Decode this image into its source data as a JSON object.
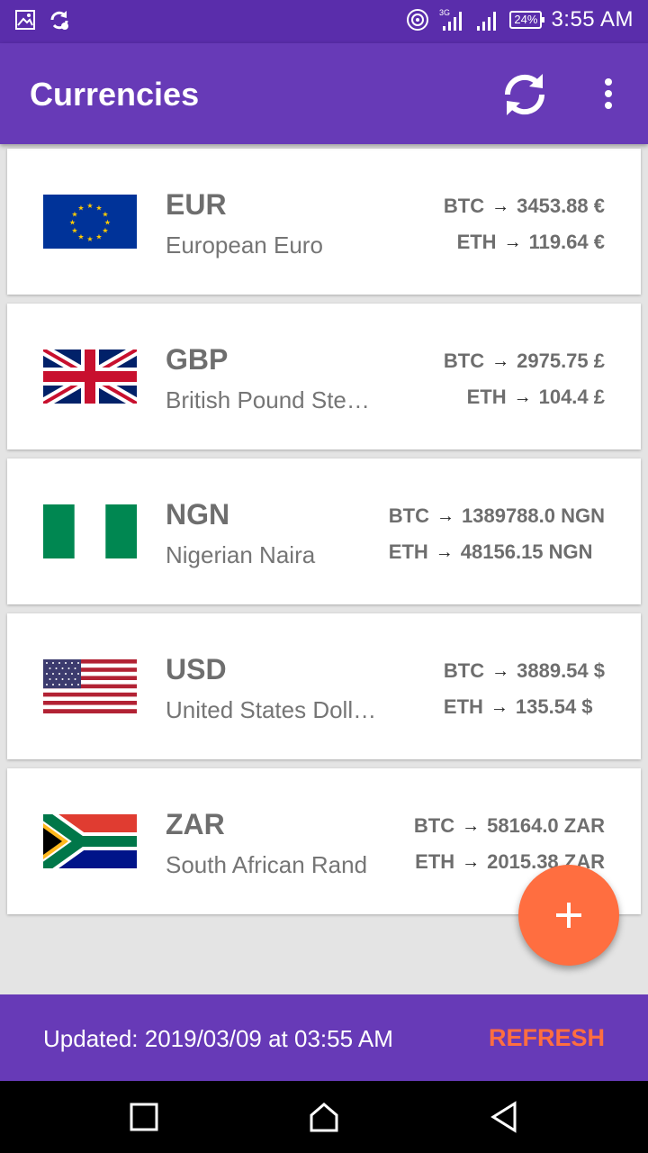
{
  "status_bar": {
    "time": "3:55 AM",
    "battery": "24%",
    "network": "3G"
  },
  "app_bar": {
    "title": "Currencies",
    "refresh_icon": "sync-icon",
    "more_icon": "more-vert-icon"
  },
  "currencies": [
    {
      "code": "EUR",
      "name": "European Euro",
      "flag": "eu-flag-icon",
      "rates": [
        {
          "label": "BTC",
          "value": "3453.88 €"
        },
        {
          "label": "ETH",
          "value": "119.64 €"
        }
      ]
    },
    {
      "code": "GBP",
      "name": "British Pound Ste…",
      "flag": "uk-flag-icon",
      "rates": [
        {
          "label": "BTC",
          "value": "2975.75 £"
        },
        {
          "label": "ETH",
          "value": "104.4 £"
        }
      ]
    },
    {
      "code": "NGN",
      "name": "Nigerian Naira",
      "flag": "nigeria-flag-icon",
      "rates": [
        {
          "label": "BTC",
          "value": "1389788.0 NGN"
        },
        {
          "label": "ETH",
          "value": "48156.15 NGN"
        }
      ]
    },
    {
      "code": "USD",
      "name": "United States Doll…",
      "flag": "us-flag-icon",
      "rates": [
        {
          "label": "BTC",
          "value": "3889.54 $"
        },
        {
          "label": "ETH",
          "value": "135.54 $"
        }
      ]
    },
    {
      "code": "ZAR",
      "name": "South African Rand",
      "flag": "south-africa-flag-icon",
      "rates": [
        {
          "label": "BTC",
          "value": "58164.0 ZAR"
        },
        {
          "label": "ETH",
          "value": "2015.38 ZAR"
        }
      ]
    }
  ],
  "arrow_glyph": "→",
  "fab": {
    "icon": "add-icon"
  },
  "footer": {
    "updated": "Updated: 2019/03/09 at 03:55 AM",
    "refresh_label": "REFRESH"
  },
  "colors": {
    "primary": "#673ab7",
    "primary_dark": "#5a2dab",
    "accent": "#ff6e40"
  }
}
